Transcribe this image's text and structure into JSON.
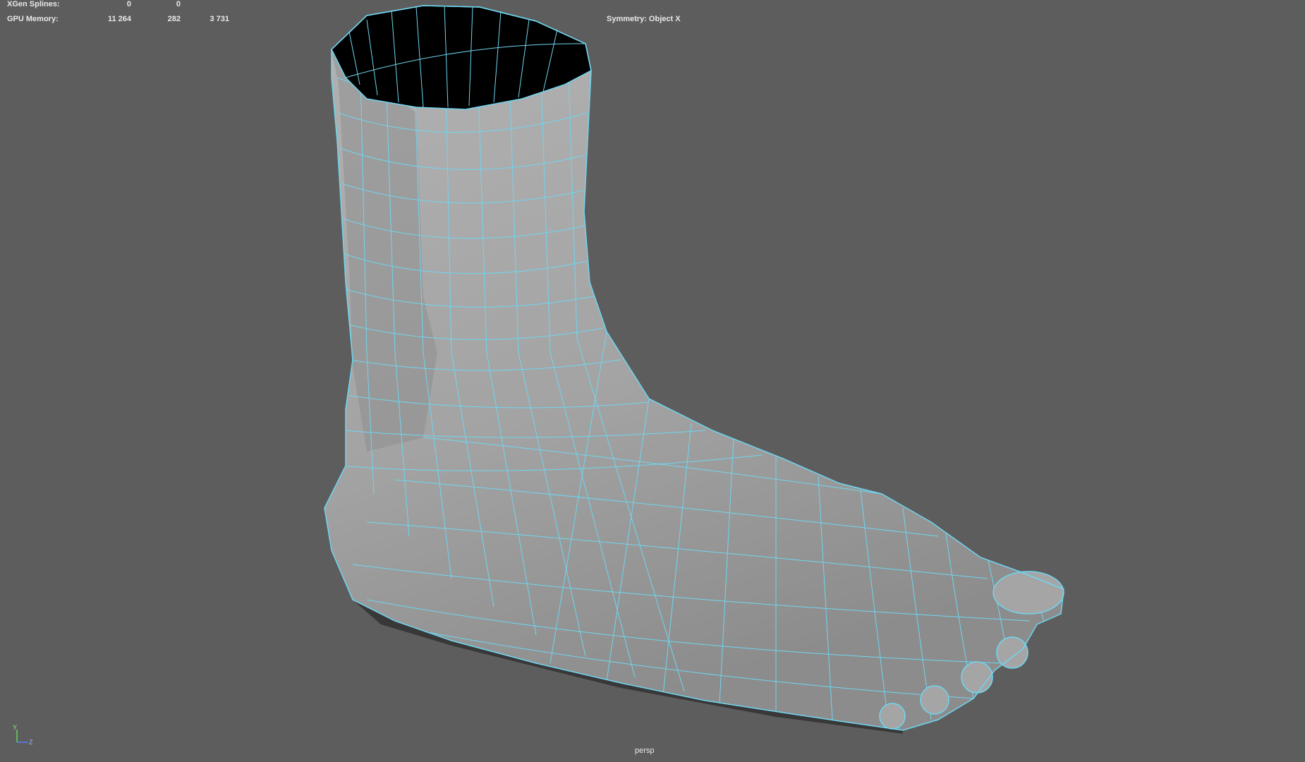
{
  "hud": {
    "rows": [
      {
        "label": "XGen Splines:",
        "values": [
          "0",
          "0",
          ""
        ]
      },
      {
        "label": "GPU Memory:",
        "values": [
          "11 264",
          "282",
          "3 731"
        ]
      }
    ],
    "symmetry": "Symmetry: Object X",
    "camera": "persp"
  },
  "axis": {
    "y": "Y",
    "z": "Z"
  },
  "colors": {
    "background": "#5d5d5d",
    "wireframe": "#6fd6f0",
    "surface": "#a6a6a6",
    "hud_text": "#e9e9e9"
  },
  "icons": [
    "axis-gizmo-icon"
  ]
}
